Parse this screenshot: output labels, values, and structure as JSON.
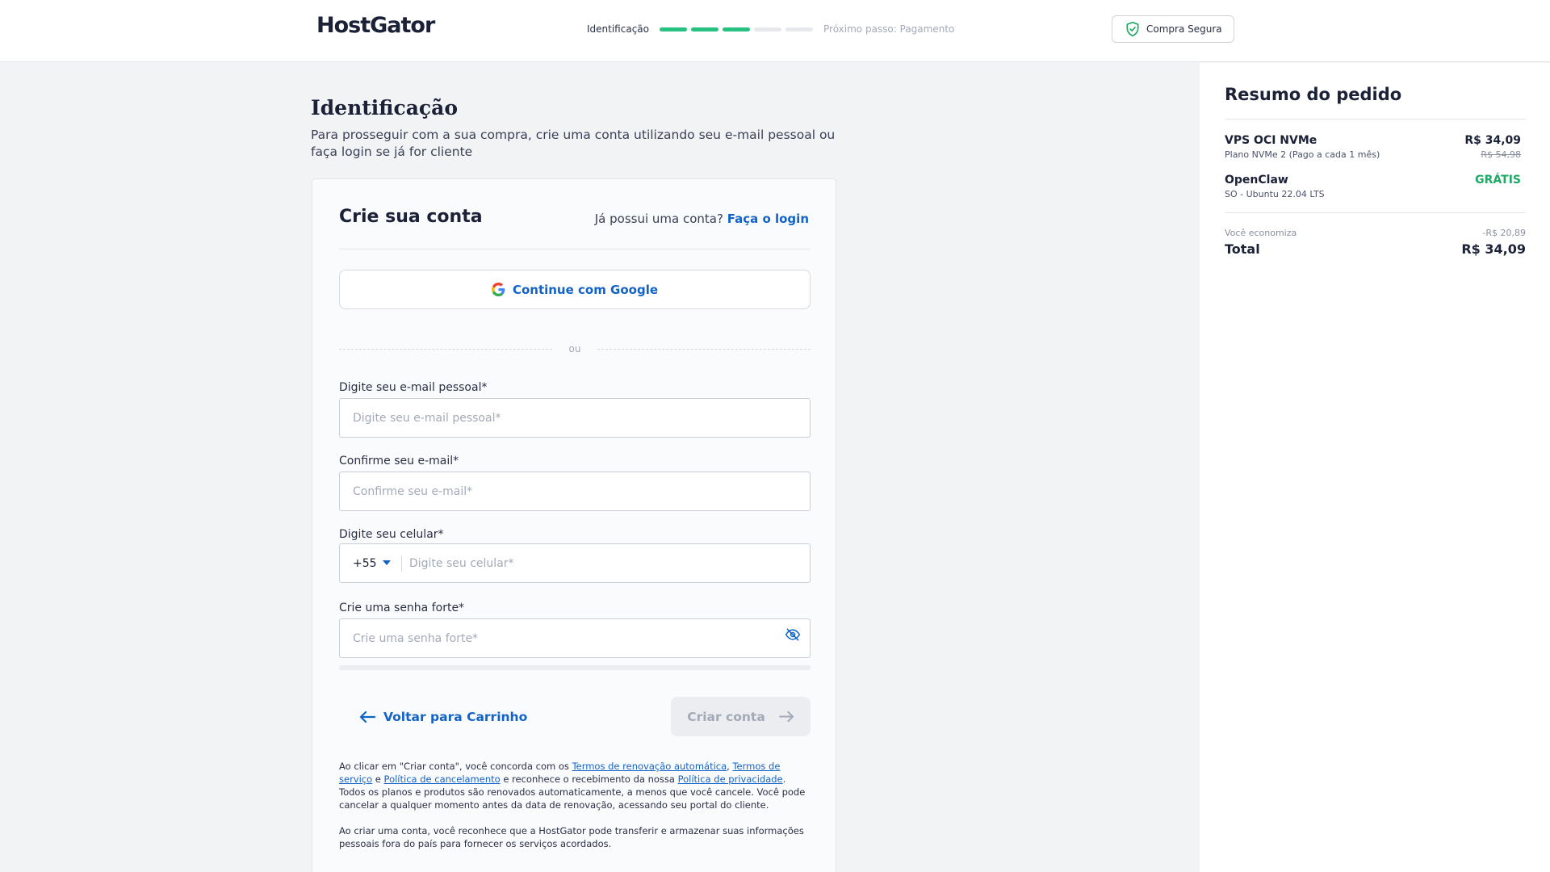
{
  "header": {
    "logo": "HostGator",
    "progress": {
      "current_label": "Identificação",
      "next_label": "Próximo passo: Pagamento",
      "completed_steps": 3,
      "total_steps": 5
    },
    "secure_badge": "Compra Segura"
  },
  "page": {
    "title": "Identificação",
    "subtitle": "Para prosseguir com a sua compra, crie uma conta utilizando seu e-mail pessoal ou faça login se já for cliente"
  },
  "card": {
    "title": "Crie sua conta",
    "login_prompt": "Já possui uma conta?",
    "login_link": "Faça o login",
    "google_button": "Continue com Google",
    "divider_text": "ou",
    "email": {
      "label": "Digite seu e-mail pessoal*",
      "placeholder": "Digite seu e-mail pessoal*",
      "value": ""
    },
    "email_confirm": {
      "label": "Confirme seu e-mail*",
      "placeholder": "Confirme seu e-mail*",
      "value": ""
    },
    "phone": {
      "label": "Digite seu celular*",
      "country_code": "+55",
      "placeholder": "Digite seu celular*",
      "value": ""
    },
    "password": {
      "label": "Crie uma senha forte*",
      "placeholder": "Crie uma senha forte*",
      "value": ""
    },
    "back_button": "Voltar para Carrinho",
    "create_button": "Criar conta",
    "legal": {
      "p1_a": "Ao clicar em \"Criar conta\", você concorda com os ",
      "link_renewal": "Termos de renovação automática",
      "p1_b": ", ",
      "link_terms": "Termos de serviço",
      "p1_c": " e ",
      "link_cancel": "Política de cancelamento",
      "p1_d": " e reconhece o recebimento da nossa ",
      "link_privacy": "Política de privacidade",
      "p1_e": ". Todos os planos e produtos são renovados automaticamente, a menos que você cancele. Você pode cancelar a qualquer momento antes da data de renovação, acessando seu portal do cliente.",
      "p2": "Ao criar uma conta, você reconhece que a HostGator pode transferir e armazenar suas informações pessoais fora do país para fornecer os serviços acordados."
    }
  },
  "summary": {
    "title": "Resumo do pedido",
    "items": [
      {
        "name": "VPS OCI NVMe",
        "desc": "Plano NVMe 2 (Pago a cada 1 mês)",
        "price": "R$ 34,09",
        "old_price": "R$ 54,98"
      },
      {
        "name": "OpenClaw",
        "desc": "SO - Ubuntu 22.04 LTS",
        "price": "GRÁTIS"
      }
    ],
    "savings_label": "Você economiza",
    "savings_value": "-R$ 20,89",
    "total_label": "Total",
    "total_value": "R$ 34,09"
  },
  "colors": {
    "accent": "#1263c7",
    "progress_done": "#27c281",
    "free": "#1fa866",
    "shield": "#1fa866"
  }
}
